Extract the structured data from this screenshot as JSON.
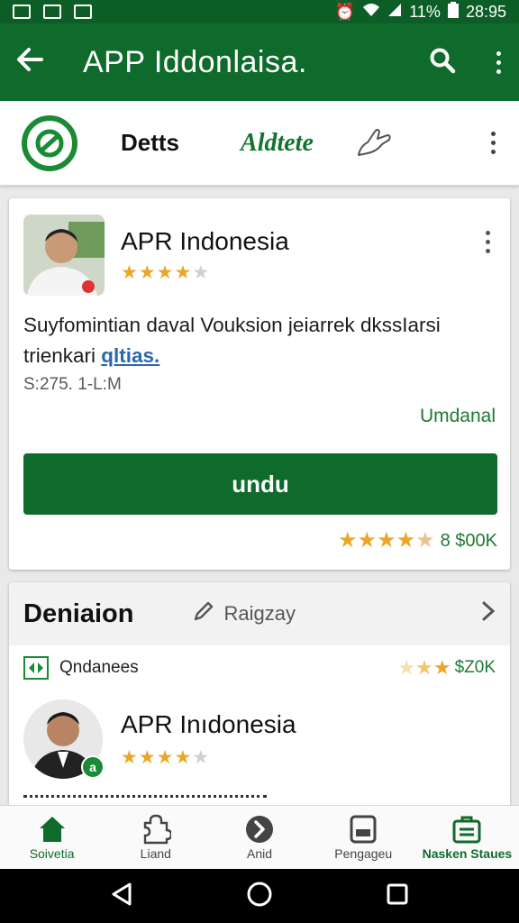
{
  "status_bar": {
    "battery_percent": "11%",
    "time": "28:95"
  },
  "app_bar": {
    "title": "APP Iddonlaisa.",
    "back_icon": "arrow-back-icon",
    "search_icon": "search-icon",
    "menu_icon": "more-vert-icon"
  },
  "tab_strip": {
    "tab_label": "Detts",
    "brand_label": "Aldtete"
  },
  "app_card": {
    "name": "APR Indonesia",
    "rating_stars": 4,
    "description": "Suyfomintian daval Vouksion jeiarrek dkssIarsi trienkari ",
    "description_link": "qltias.",
    "size": "S:275. 1-L:M",
    "status": "Umdanal",
    "install_label": "undu",
    "footer_rating_stars": 4.5,
    "footer_rating_value": "8 $00K"
  },
  "section": {
    "title": "Deniaion",
    "edit_label": "Raigzay",
    "sub_label": "Qndanees",
    "sub_rating_stars": 3,
    "sub_rating_value": "$Z0K",
    "item_name": "APR Inıdonesia",
    "item_rating_stars": 4
  },
  "bottom_nav": [
    {
      "label": "Soivetia",
      "icon": "home-icon"
    },
    {
      "label": "Liand",
      "icon": "puzzle-icon"
    },
    {
      "label": "Anid",
      "icon": "arrow-circle-icon"
    },
    {
      "label": "Pengageu",
      "icon": "device-icon"
    },
    {
      "label": "Nasken Staues",
      "icon": "briefcase-icon"
    }
  ],
  "colors": {
    "primary": "#0f6b2c",
    "status_bar": "#0d5d26",
    "accent_green": "#1f7a34",
    "star": "#eba62a",
    "link": "#2b67a9"
  }
}
